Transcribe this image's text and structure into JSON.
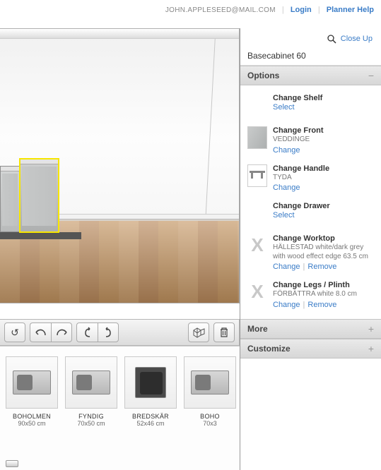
{
  "header": {
    "email": "JOHN.APPLESEED@MAIL.COM",
    "login": "Login",
    "help": "Planner Help"
  },
  "viewer": {
    "closeup_label": "Close Up",
    "selected_item": "Basecabinet 60"
  },
  "toolbar": {
    "reset": "↺",
    "undo": "↶",
    "redo": "↷",
    "rotate_ccw": "↶",
    "rotate_cw": "↷",
    "view3d": "▣",
    "delete": "🗑"
  },
  "panel": {
    "sections": {
      "options": "Options",
      "more": "More",
      "customize": "Customize"
    },
    "actions": {
      "select": "Select",
      "change": "Change",
      "remove": "Remove"
    },
    "options": [
      {
        "title": "Change Shelf",
        "sub": "",
        "thumb": "none",
        "links": [
          "select"
        ]
      },
      {
        "title": "Change Front",
        "sub": "VEDDINGE",
        "thumb": "front",
        "links": [
          "change"
        ]
      },
      {
        "title": "Change Handle",
        "sub": "TYDA",
        "thumb": "handle",
        "links": [
          "change"
        ]
      },
      {
        "title": "Change Drawer",
        "sub": "",
        "thumb": "none",
        "links": [
          "select"
        ]
      },
      {
        "title": "Change Worktop",
        "sub": "HÄLLESTAD white/dark grey with wood effect edge 63.5 cm",
        "thumb": "x",
        "links": [
          "change",
          "remove"
        ]
      },
      {
        "title": "Change Legs / Plinth",
        "sub": "FÖRBÄTTRA white 8.0 cm",
        "thumb": "x",
        "links": [
          "change",
          "remove"
        ]
      }
    ]
  },
  "catalog": {
    "items": [
      {
        "name": "BOHOLMEN",
        "dim": "90x50 cm",
        "style": ""
      },
      {
        "name": "FYNDIG",
        "dim": "70x50 cm",
        "style": ""
      },
      {
        "name": "BREDSKÄR",
        "dim": "52x46 cm",
        "style": "sq"
      },
      {
        "name": "BOHO",
        "dim": "70x3",
        "style": ""
      }
    ]
  }
}
